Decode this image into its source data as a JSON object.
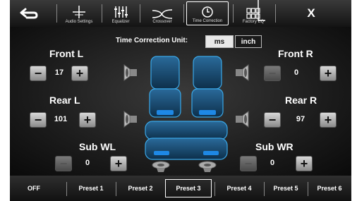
{
  "topbar": {
    "back_icon": "back-arrow-icon",
    "tabs": [
      {
        "label": "Audio Settings",
        "icon": "crosshair-icon"
      },
      {
        "label": "Equalizer",
        "icon": "sliders-icon"
      },
      {
        "label": "Crossover",
        "icon": "crossover-curve-icon"
      },
      {
        "label": "Time Correction",
        "icon": "clock-icon",
        "active": true
      },
      {
        "label": "Factory EQ",
        "icon": "grid-icon"
      }
    ],
    "close_label": "X"
  },
  "time_correction": {
    "label": "Time Correction Unit:",
    "units": [
      "ms",
      "inch"
    ],
    "selected_unit": "ms"
  },
  "channels": {
    "front_l": {
      "label": "Front L",
      "value": "17"
    },
    "front_r": {
      "label": "Front R",
      "value": "0"
    },
    "rear_l": {
      "label": "Rear L",
      "value": "101"
    },
    "rear_r": {
      "label": "Rear R",
      "value": "97"
    },
    "sub_wl": {
      "label": "Sub WL",
      "value": "0"
    },
    "sub_wr": {
      "label": "Sub WR",
      "value": "0"
    }
  },
  "presets": {
    "off_label": "OFF",
    "items": [
      "Preset 1",
      "Preset 2",
      "Preset 3",
      "Preset 4",
      "Preset 5",
      "Preset 6"
    ],
    "active": "Preset 3"
  },
  "colors": {
    "seat_glow": "#3aa8e8",
    "seat_highlight": "#1e88e5",
    "background": "#000000"
  }
}
